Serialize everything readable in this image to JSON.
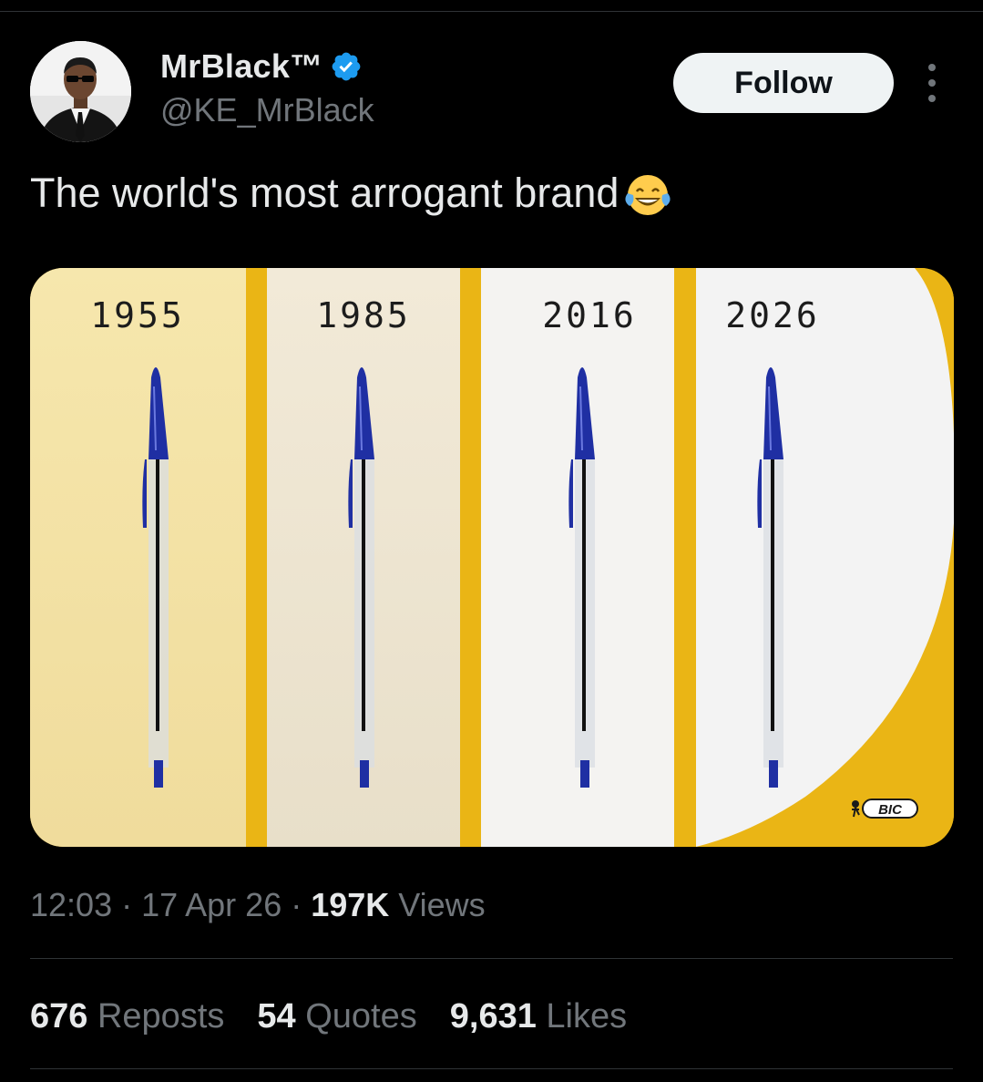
{
  "author": {
    "display_name": "MrBlack™",
    "handle": "@KE_MrBlack",
    "verified": true,
    "avatar_icon": "avatar-man-in-suit-sunglasses"
  },
  "follow_label": "Follow",
  "more_icon": "more-horizontal-icon",
  "tweet": {
    "text": "The world's most arrogant brand",
    "emoji": "face-with-tears-of-joy"
  },
  "media": {
    "panels": [
      {
        "year": "1955"
      },
      {
        "year": "1985"
      },
      {
        "year": "2016"
      },
      {
        "year": "2026"
      }
    ],
    "logo_text": "BIC",
    "pen_cap_color": "#1f2fa3",
    "background_accent": "#eab515"
  },
  "meta": {
    "time": "12:03",
    "separator": " · ",
    "date": "17 Apr 26",
    "views_count": "197K",
    "views_label": "Views"
  },
  "stats": {
    "reposts_count": "676",
    "reposts_label": "Reposts",
    "quotes_count": "54",
    "quotes_label": "Quotes",
    "likes_count": "9,631",
    "likes_label": "Likes"
  },
  "colors": {
    "background": "#000000",
    "text_primary": "#e7e9ea",
    "text_secondary": "#71767b",
    "verified_blue": "#1d9bf0",
    "divider": "#2f3336"
  }
}
